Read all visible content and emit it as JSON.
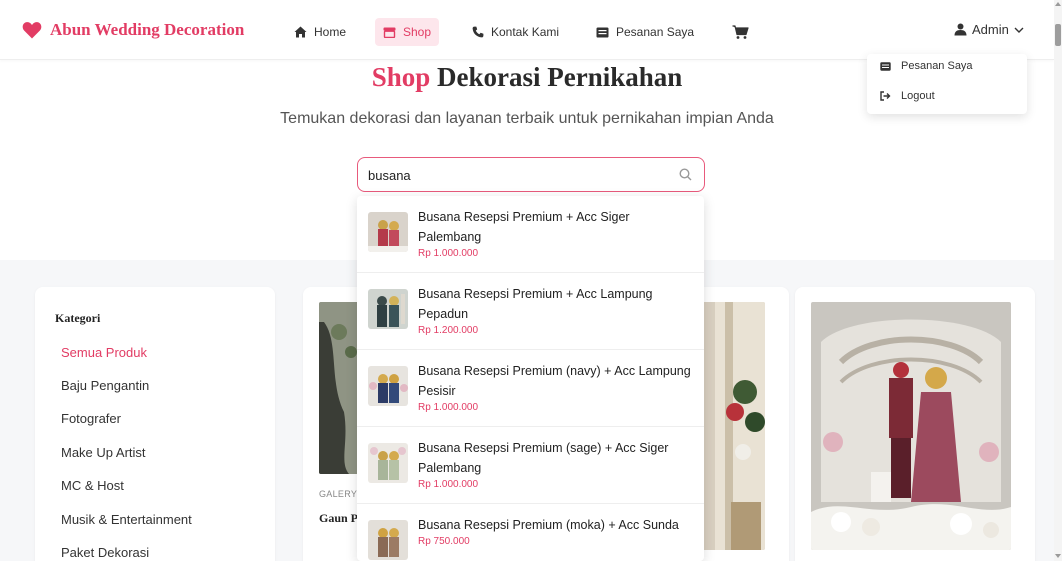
{
  "brand": {
    "name": "Abun Wedding Decoration",
    "color": "#e23c64"
  },
  "nav": {
    "home": "Home",
    "shop": "Shop",
    "contact": "Kontak Kami",
    "orders": "Pesanan Saya"
  },
  "admin": {
    "label": "Admin",
    "menu": {
      "orders": "Pesanan Saya",
      "logout": "Logout"
    }
  },
  "hero": {
    "title_accent": "Shop",
    "title_rest": "Dekorasi Pernikahan",
    "subtitle": "Temukan dekorasi dan layanan terbaik untuk pernikahan impian Anda"
  },
  "search": {
    "value": "busana"
  },
  "suggestions": [
    {
      "name": "Busana Resepsi Premium + Acc Siger Palembang",
      "price": "Rp 1.000.000"
    },
    {
      "name": "Busana Resepsi Premium + Acc Lampung Pepadun",
      "price": "Rp 1.200.000"
    },
    {
      "name": "Busana Resepsi Premium (navy) + Acc Lampung Pesisir",
      "price": "Rp 1.000.000"
    },
    {
      "name": "Busana Resepsi Premium (sage) + Acc Siger Palembang",
      "price": "Rp 1.000.000"
    },
    {
      "name": "Busana Resepsi Premium (moka) + Acc Sunda",
      "price": "Rp 750.000"
    }
  ],
  "sidebar": {
    "title": "Kategori",
    "categories": [
      "Semua Produk",
      "Baju Pengantin",
      "Fotografer",
      "Make Up Artist",
      "MC & Host",
      "Musik & Entertainment",
      "Paket Dekorasi"
    ]
  },
  "cards": [
    {
      "category": "GALERY",
      "name": "Gaun Pengantin"
    }
  ]
}
